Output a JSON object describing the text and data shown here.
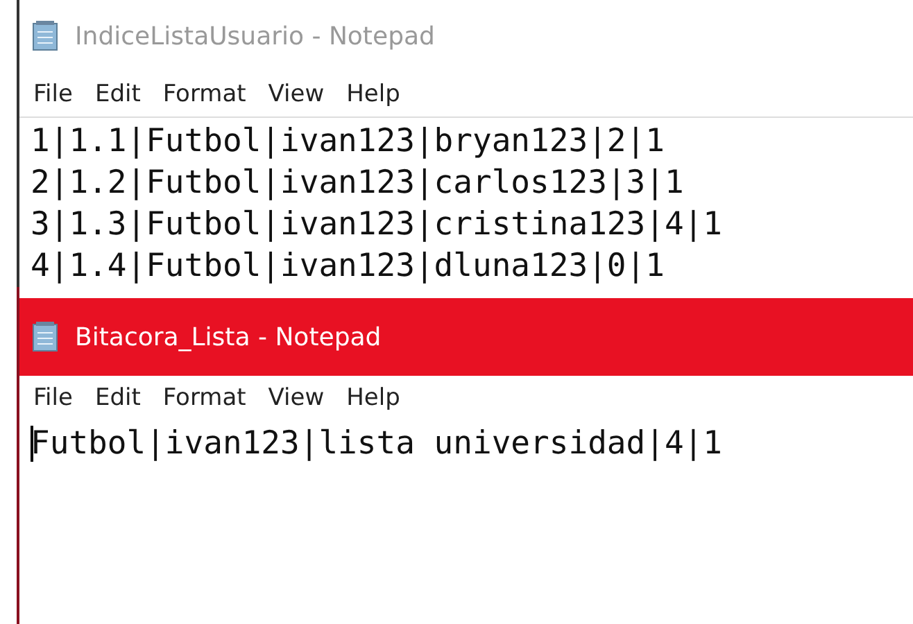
{
  "windows": [
    {
      "title": "IndiceListaUsuario - Notepad",
      "active": false,
      "menu": [
        "File",
        "Edit",
        "Format",
        "View",
        "Help"
      ],
      "caret": false,
      "lines": [
        "1|1.1|Futbol|ivan123|bryan123|2|1",
        "2|1.2|Futbol|ivan123|carlos123|3|1",
        "3|1.3|Futbol|ivan123|cristina123|4|1",
        "4|1.4|Futbol|ivan123|dluna123|0|1"
      ]
    },
    {
      "title": "Bitacora_Lista - Notepad",
      "active": true,
      "menu": [
        "File",
        "Edit",
        "Format",
        "View",
        "Help"
      ],
      "caret": true,
      "lines": [
        "Futbol|ivan123|lista universidad|4|1"
      ]
    }
  ]
}
